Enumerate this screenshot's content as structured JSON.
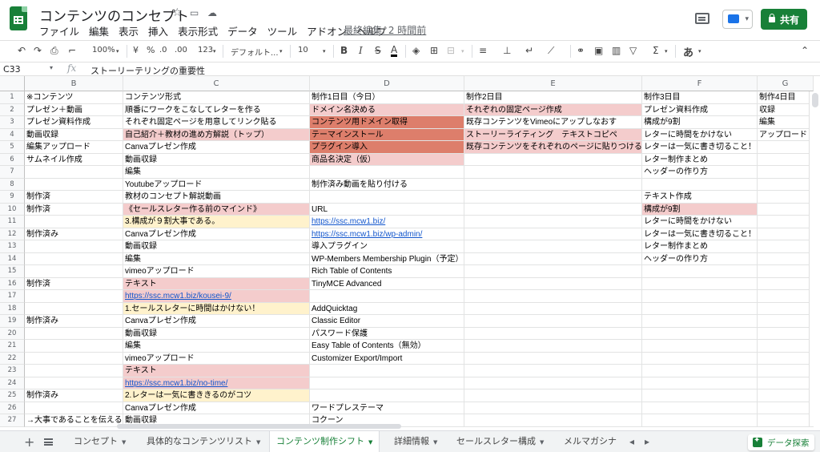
{
  "title": "コンテンツのコンセプト",
  "title_icons": [
    "star-icon",
    "folder-move-icon",
    "cloud-status-icon"
  ],
  "menu": [
    "ファイル",
    "編集",
    "表示",
    "挿入",
    "表示形式",
    "データ",
    "ツール",
    "アドオン",
    "ヘルプ"
  ],
  "last_edit": "最終編集: 2 時間前",
  "share_label": "共有",
  "toolbar": {
    "zoom": "100%",
    "currency": "¥",
    "percent": "%",
    "dec_less": ".0",
    "dec_more": ".00",
    "more_formats": "123",
    "font": "デフォルト...",
    "font_size": "10",
    "bold": "B",
    "italic": "I",
    "strike": "S",
    "text_color": "A",
    "sigma": "Σ",
    "input_tools": "あ"
  },
  "name_box": "C33",
  "fx": "fx",
  "formula": "ストーリーテリングの重要性",
  "columns": [
    "B",
    "C",
    "D",
    "E",
    "F",
    "G"
  ],
  "rows": [
    {
      "num": "1",
      "cells": [
        {
          "t": "※コンテンツ"
        },
        {
          "t": "コンテンツ形式"
        },
        {
          "t": "制作1日目（今日）"
        },
        {
          "t": "制作2日目"
        },
        {
          "t": "制作3日目"
        },
        {
          "t": "制作4日目"
        }
      ]
    },
    {
      "num": "2",
      "cells": [
        {
          "t": "プレゼン＋動画"
        },
        {
          "t": "順番にワークをこなしてレターを作る"
        },
        {
          "t": "ドメイン名決める",
          "c": "pink"
        },
        {
          "t": "それぞれの固定ページ作成",
          "c": "pink"
        },
        {
          "t": "プレゼン資料作成"
        },
        {
          "t": "収録"
        }
      ]
    },
    {
      "num": "3",
      "cells": [
        {
          "t": "プレゼン資料作成"
        },
        {
          "t": "それぞれ固定ページを用意してリンク貼る"
        },
        {
          "t": "コンテンツ用ドメイン取得",
          "c": "darkred"
        },
        {
          "t": "既存コンテンツをVimeoにアップしなおす"
        },
        {
          "t": "構成が9割"
        },
        {
          "t": "編集"
        }
      ]
    },
    {
      "num": "4",
      "cells": [
        {
          "t": "動画収録"
        },
        {
          "t": "自己紹介＋教材の進め方解説（トップ）",
          "c": "pink"
        },
        {
          "t": "テーマインストール",
          "c": "darkred"
        },
        {
          "t": "ストーリーライティング　テキストコピペ",
          "c": "pink"
        },
        {
          "t": "レターに時間をかけない"
        },
        {
          "t": "アップロード"
        }
      ]
    },
    {
      "num": "5",
      "cells": [
        {
          "t": "編集アップロード"
        },
        {
          "t": "Canvaプレゼン作成"
        },
        {
          "t": "プラグイン導入",
          "c": "darkred"
        },
        {
          "t": "既存コンテンツをそれぞれのページに貼りつける",
          "c": "pink"
        },
        {
          "t": "レターは一気に書き切ること！"
        },
        {
          "t": ""
        }
      ]
    },
    {
      "num": "6",
      "cells": [
        {
          "t": "サムネイル作成"
        },
        {
          "t": "動画収録"
        },
        {
          "t": "商品名決定（仮）",
          "c": "pink"
        },
        {
          "t": ""
        },
        {
          "t": "レター制作まとめ"
        },
        {
          "t": ""
        }
      ]
    },
    {
      "num": "7",
      "cells": [
        {
          "t": ""
        },
        {
          "t": "編集"
        },
        {
          "t": ""
        },
        {
          "t": ""
        },
        {
          "t": "ヘッダーの作り方"
        },
        {
          "t": ""
        }
      ]
    },
    {
      "num": "8",
      "cells": [
        {
          "t": ""
        },
        {
          "t": "Youtubeアップロード"
        },
        {
          "t": "制作済み動画を貼り付ける"
        },
        {
          "t": ""
        },
        {
          "t": ""
        },
        {
          "t": ""
        }
      ]
    },
    {
      "num": "9",
      "cells": [
        {
          "t": "制作済"
        },
        {
          "t": "教材のコンセプト解説動画"
        },
        {
          "t": ""
        },
        {
          "t": ""
        },
        {
          "t": "テキスト作成"
        },
        {
          "t": ""
        }
      ]
    },
    {
      "num": "10",
      "cells": [
        {
          "t": "制作済"
        },
        {
          "t": "《セールスレター作る前のマインド》",
          "c": "pink"
        },
        {
          "t": "URL"
        },
        {
          "t": ""
        },
        {
          "t": "構成が9割",
          "c": "pink"
        },
        {
          "t": ""
        }
      ]
    },
    {
      "num": "11",
      "cells": [
        {
          "t": ""
        },
        {
          "t": "3.構成が９割大事である。",
          "c": "yellow"
        },
        {
          "t": "https://ssc.mcw1.biz/",
          "c": "link"
        },
        {
          "t": ""
        },
        {
          "t": "レターに時間をかけない"
        },
        {
          "t": ""
        }
      ]
    },
    {
      "num": "12",
      "cells": [
        {
          "t": "制作済み"
        },
        {
          "t": "Canvaプレゼン作成"
        },
        {
          "t": "https://ssc.mcw1.biz/wp-admin/",
          "c": "link"
        },
        {
          "t": ""
        },
        {
          "t": "レターは一気に書き切ること！"
        },
        {
          "t": ""
        }
      ]
    },
    {
      "num": "13",
      "cells": [
        {
          "t": ""
        },
        {
          "t": "動画収録"
        },
        {
          "t": "導入プラグイン"
        },
        {
          "t": ""
        },
        {
          "t": "レター制作まとめ"
        },
        {
          "t": ""
        }
      ]
    },
    {
      "num": "14",
      "cells": [
        {
          "t": ""
        },
        {
          "t": "編集"
        },
        {
          "t": "WP-Members Membership Plugin（予定）"
        },
        {
          "t": ""
        },
        {
          "t": "ヘッダーの作り方"
        },
        {
          "t": ""
        }
      ]
    },
    {
      "num": "15",
      "cells": [
        {
          "t": ""
        },
        {
          "t": "vimeoアップロード"
        },
        {
          "t": "Rich Table of Contents"
        },
        {
          "t": ""
        },
        {
          "t": ""
        },
        {
          "t": ""
        }
      ]
    },
    {
      "num": "16",
      "cells": [
        {
          "t": "制作済"
        },
        {
          "t": "テキスト",
          "c": "pink"
        },
        {
          "t": "TinyMCE Advanced"
        },
        {
          "t": ""
        },
        {
          "t": ""
        },
        {
          "t": ""
        }
      ]
    },
    {
      "num": "17",
      "cells": [
        {
          "t": ""
        },
        {
          "t": "https://ssc.mcw1.biz/kousei-9/",
          "c": "pink link"
        },
        {
          "t": ""
        },
        {
          "t": ""
        },
        {
          "t": ""
        },
        {
          "t": ""
        }
      ]
    },
    {
      "num": "18",
      "cells": [
        {
          "t": ""
        },
        {
          "t": "1.セールスレターに時間はかけない！",
          "c": "yellow"
        },
        {
          "t": "AddQuicktag"
        },
        {
          "t": ""
        },
        {
          "t": ""
        },
        {
          "t": ""
        }
      ]
    },
    {
      "num": "19",
      "cells": [
        {
          "t": "制作済み"
        },
        {
          "t": "Canvaプレゼン作成"
        },
        {
          "t": "Classic Editor"
        },
        {
          "t": ""
        },
        {
          "t": ""
        },
        {
          "t": ""
        }
      ]
    },
    {
      "num": "20",
      "cells": [
        {
          "t": ""
        },
        {
          "t": "動画収録"
        },
        {
          "t": "パスワード保護"
        },
        {
          "t": ""
        },
        {
          "t": ""
        },
        {
          "t": ""
        }
      ]
    },
    {
      "num": "21",
      "cells": [
        {
          "t": ""
        },
        {
          "t": "編集"
        },
        {
          "t": "Easy Table of Contents（無効）"
        },
        {
          "t": ""
        },
        {
          "t": ""
        },
        {
          "t": ""
        }
      ]
    },
    {
      "num": "22",
      "cells": [
        {
          "t": ""
        },
        {
          "t": "vimeoアップロード"
        },
        {
          "t": "Customizer Export/Import"
        },
        {
          "t": ""
        },
        {
          "t": ""
        },
        {
          "t": ""
        }
      ]
    },
    {
      "num": "23",
      "cells": [
        {
          "t": ""
        },
        {
          "t": "テキスト",
          "c": "pink"
        },
        {
          "t": ""
        },
        {
          "t": ""
        },
        {
          "t": ""
        },
        {
          "t": ""
        }
      ]
    },
    {
      "num": "24",
      "cells": [
        {
          "t": ""
        },
        {
          "t": "https://ssc.mcw1.biz/no-time/",
          "c": "pink link"
        },
        {
          "t": ""
        },
        {
          "t": ""
        },
        {
          "t": ""
        },
        {
          "t": ""
        }
      ]
    },
    {
      "num": "25",
      "cells": [
        {
          "t": "制作済み"
        },
        {
          "t": "2.レターは一気に書ききるのがコツ",
          "c": "yellow"
        },
        {
          "t": ""
        },
        {
          "t": ""
        },
        {
          "t": ""
        },
        {
          "t": ""
        }
      ]
    },
    {
      "num": "26",
      "cells": [
        {
          "t": ""
        },
        {
          "t": "Canvaプレゼン作成"
        },
        {
          "t": "ワードプレステーマ"
        },
        {
          "t": ""
        },
        {
          "t": ""
        },
        {
          "t": ""
        }
      ]
    },
    {
      "num": "27",
      "cells": [
        {
          "t": "→大事であることを伝える"
        },
        {
          "t": "動画収録"
        },
        {
          "t": "コクーン"
        },
        {
          "t": ""
        },
        {
          "t": ""
        },
        {
          "t": ""
        }
      ]
    }
  ],
  "tabs": [
    "コンセプト",
    "具体的なコンテンツリスト",
    "コンテンツ制作シフト",
    "詳細情報",
    "セールスレター構成",
    "メルマガシナ"
  ],
  "active_tab": 2,
  "explore_label": "データ探索",
  "colors": {
    "green": "#188038",
    "pink": "#f4cccc",
    "dark_red": "#dd7e6b",
    "light_yellow": "#fff2cc",
    "link": "#1155cc"
  }
}
